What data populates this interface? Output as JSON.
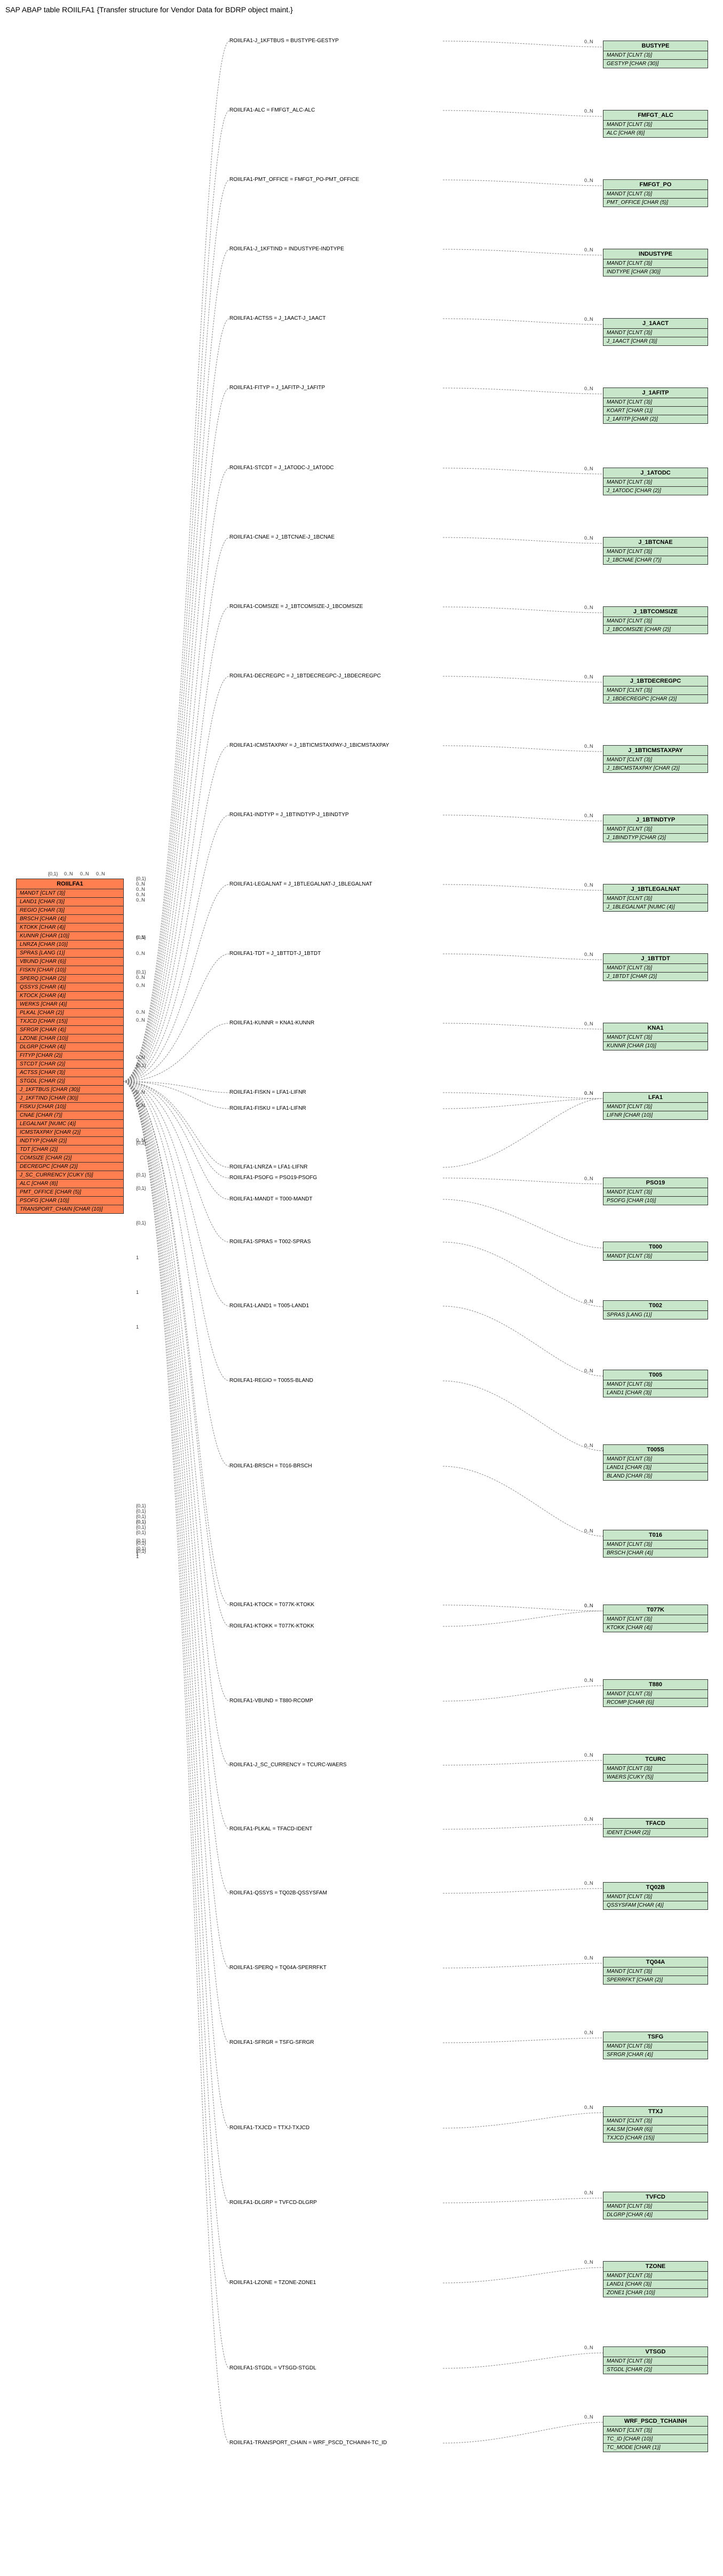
{
  "title": "SAP ABAP table ROIILFA1 {Transfer structure for Vendor Data for BDRP object maint.}",
  "main_entity": {
    "name": "ROIILFA1",
    "fields": [
      "MANDT [CLNT (3)]",
      "LAND1 [CHAR (3)]",
      "REGIO [CHAR (3)]",
      "BRSCH [CHAR (4)]",
      "KTOKK [CHAR (4)]",
      "KUNNR [CHAR (10)]",
      "LNRZA [CHAR (10)]",
      "SPRAS [LANG (1)]",
      "VBUND [CHAR (6)]",
      "FISKN [CHAR (10)]",
      "SPERQ [CHAR (2)]",
      "QSSYS [CHAR (4)]",
      "KTOCK [CHAR (4)]",
      "WERKS [CHAR (4)]",
      "PLKAL [CHAR (2)]",
      "TXJCD [CHAR (15)]",
      "SFRGR [CHAR (4)]",
      "LZONE [CHAR (10)]",
      "DLGRP [CHAR (4)]",
      "FITYP [CHAR (2)]",
      "STCDT [CHAR (2)]",
      "ACTSS [CHAR (3)]",
      "STGDL [CHAR (2)]",
      "J_1KFTBUS [CHAR (30)]",
      "J_1KFTIND [CHAR (30)]",
      "FISKU [CHAR (10)]",
      "CNAE [CHAR (7)]",
      "LEGALNAT [NUMC (4)]",
      "ICMSTAXPAY [CHAR (2)]",
      "INDTYP [CHAR (2)]",
      "TDT [CHAR (2)]",
      "COMSIZE [CHAR (2)]",
      "DECREGPC [CHAR (2)]",
      "J_SC_CURRENCY [CUKY (5)]",
      "ALC [CHAR (8)]",
      "PMT_OFFICE [CHAR (5)]",
      "PSOFG [CHAR (10)]",
      "TRANSPORT_CHAIN [CHAR (10)]"
    ]
  },
  "src_cards": [
    "{0,1}",
    "0..N",
    "0..N",
    "0..N",
    "0..N",
    "0..N",
    "0..N",
    "0..N",
    "0..N",
    "0..N",
    "0..N",
    "0..N",
    "0..N",
    "0..N",
    "0..N",
    "{0,1}",
    "{0,1}",
    "{0,1}",
    "{0,1}",
    "1",
    "1",
    "1",
    "{0,1}",
    "{0,1}",
    "{0,1}",
    "{0,1}",
    "{0,1}",
    "{0,1}",
    "{0,1}",
    "{0,1}",
    "{0,1}",
    "{0,1}",
    "{0,1}",
    "{0,1}",
    "{0,1}",
    "{0,1}",
    "1",
    "1"
  ],
  "src_card_left": [
    "{0,1}",
    "0..N",
    "0..N",
    "0..N"
  ],
  "edges": [
    {
      "label": "ROIILFA1-J_1KFTBUS = BUSTYPE-GESTYP",
      "card": "0..N"
    },
    {
      "label": "ROIILFA1-ALC = FMFGT_ALC-ALC",
      "card": "0..N"
    },
    {
      "label": "ROIILFA1-PMT_OFFICE = FMFGT_PO-PMT_OFFICE",
      "card": "0..N"
    },
    {
      "label": "ROIILFA1-J_1KFTIND = INDUSTYPE-INDTYPE",
      "card": "0..N"
    },
    {
      "label": "ROIILFA1-ACTSS = J_1AACT-J_1AACT",
      "card": "0..N"
    },
    {
      "label": "ROIILFA1-FITYP = J_1AFITP-J_1AFITP",
      "card": "0..N"
    },
    {
      "label": "ROIILFA1-STCDT = J_1ATODC-J_1ATODC",
      "card": "0..N"
    },
    {
      "label": "ROIILFA1-CNAE = J_1BTCNAE-J_1BCNAE",
      "card": "0..N"
    },
    {
      "label": "ROIILFA1-COMSIZE = J_1BTCOMSIZE-J_1BCOMSIZE",
      "card": "0..N"
    },
    {
      "label": "ROIILFA1-DECREGPC = J_1BTDECREGPC-J_1BDECREGPC",
      "card": "0..N"
    },
    {
      "label": "ROIILFA1-ICMSTAXPAY = J_1BTICMSTAXPAY-J_1BICMSTAXPAY",
      "card": "0..N"
    },
    {
      "label": "ROIILFA1-INDTYP = J_1BTINDTYP-J_1BINDTYP",
      "card": "0..N"
    },
    {
      "label": "ROIILFA1-LEGALNAT = J_1BTLEGALNAT-J_1BLEGALNAT",
      "card": "0..N"
    },
    {
      "label": "ROIILFA1-TDT = J_1BTTDT-J_1BTDT",
      "card": "0..N"
    },
    {
      "label": "ROIILFA1-KUNNR = KNA1-KUNNR",
      "card": "0..N"
    },
    {
      "label": "ROIILFA1-FISKN = LFA1-LIFNR",
      "card": "0..N"
    },
    {
      "label": "ROIILFA1-FISKU = LFA1-LIFNR",
      "card": "0..N"
    },
    {
      "label": "ROIILFA1-LNRZA = LFA1-LIFNR",
      "card": ""
    },
    {
      "label": "ROIILFA1-PSOFG = PSO19-PSOFG",
      "card": "0..N"
    },
    {
      "label": "ROIILFA1-MANDT = T000-MANDT",
      "card": ""
    },
    {
      "label": "ROIILFA1-SPRAS = T002-SPRAS",
      "card": "0..N"
    },
    {
      "label": "ROIILFA1-LAND1 = T005-LAND1",
      "card": "0..N"
    },
    {
      "label": "ROIILFA1-REGIO = T005S-BLAND",
      "card": "0..N"
    },
    {
      "label": "ROIILFA1-BRSCH = T016-BRSCH",
      "card": "0..N"
    },
    {
      "label": "ROIILFA1-KTOCK = T077K-KTOKK",
      "card": "0..N"
    },
    {
      "label": "ROIILFA1-KTOKK = T077K-KTOKK",
      "card": "0..N"
    },
    {
      "label": "ROIILFA1-VBUND = T880-RCOMP",
      "card": "0..N"
    },
    {
      "label": "ROIILFA1-J_SC_CURRENCY = TCURC-WAERS",
      "card": "0..N"
    },
    {
      "label": "ROIILFA1-PLKAL = TFACD-IDENT",
      "card": "0..N"
    },
    {
      "label": "ROIILFA1-QSSYS = TQ02B-QSSYSFAM",
      "card": "0..N"
    },
    {
      "label": "ROIILFA1-SPERQ = TQ04A-SPERRFKT",
      "card": "0..N"
    },
    {
      "label": "ROIILFA1-SFRGR = TSFG-SFRGR",
      "card": "0..N"
    },
    {
      "label": "ROIILFA1-TXJCD = TTXJ-TXJCD",
      "card": "0..N"
    },
    {
      "label": "ROIILFA1-DLGRP = TVFCD-DLGRP",
      "card": "0..N"
    },
    {
      "label": "ROIILFA1-LZONE = TZONE-ZONE1",
      "card": "0..N"
    },
    {
      "label": "ROIILFA1-STGDL = VTSGD-STGDL",
      "card": "0..N"
    },
    {
      "label": "ROIILFA1-TRANSPORT_CHAIN = WRF_PSCD_TCHAINH-TC_ID",
      "card": "0..N"
    }
  ],
  "targets": [
    {
      "name": "BUSTYPE",
      "fields": [
        "MANDT [CLNT (3)]",
        "GESTYP [CHAR (30)]"
      ]
    },
    {
      "name": "FMFGT_ALC",
      "fields": [
        "MANDT [CLNT (3)]",
        "ALC [CHAR (8)]"
      ]
    },
    {
      "name": "FMFGT_PO",
      "fields": [
        "MANDT [CLNT (3)]",
        "PMT_OFFICE [CHAR (5)]"
      ]
    },
    {
      "name": "INDUSTYPE",
      "fields": [
        "MANDT [CLNT (3)]",
        "INDTYPE [CHAR (30)]"
      ]
    },
    {
      "name": "J_1AACT",
      "fields": [
        "MANDT [CLNT (3)]",
        "J_1AACT [CHAR (3)]"
      ]
    },
    {
      "name": "J_1AFITP",
      "fields": [
        "MANDT [CLNT (3)]",
        "KOART [CHAR (1)]",
        "J_1AFITP [CHAR (2)]"
      ]
    },
    {
      "name": "J_1ATODC",
      "fields": [
        "MANDT [CLNT (3)]",
        "J_1ATODC [CHAR (2)]"
      ]
    },
    {
      "name": "J_1BTCNAE",
      "fields": [
        "MANDT [CLNT (3)]",
        "J_1BCNAE [CHAR (7)]"
      ]
    },
    {
      "name": "J_1BTCOMSIZE",
      "fields": [
        "MANDT [CLNT (3)]",
        "J_1BCOMSIZE [CHAR (2)]"
      ]
    },
    {
      "name": "J_1BTDECREGPC",
      "fields": [
        "MANDT [CLNT (3)]",
        "J_1BDECREGPC [CHAR (2)]"
      ]
    },
    {
      "name": "J_1BTICMSTAXPAY",
      "fields": [
        "MANDT [CLNT (3)]",
        "J_1BICMSTAXPAY [CHAR (2)]"
      ]
    },
    {
      "name": "J_1BTINDTYP",
      "fields": [
        "MANDT [CLNT (3)]",
        "J_1BINDTYP [CHAR (2)]"
      ]
    },
    {
      "name": "J_1BTLEGALNAT",
      "fields": [
        "MANDT [CLNT (3)]",
        "J_1BLEGALNAT [NUMC (4)]"
      ]
    },
    {
      "name": "J_1BTTDT",
      "fields": [
        "MANDT [CLNT (3)]",
        "J_1BTDT [CHAR (2)]"
      ]
    },
    {
      "name": "KNA1",
      "fields": [
        "MANDT [CLNT (3)]",
        "KUNNR [CHAR (10)]"
      ]
    },
    {
      "name": "LFA1",
      "fields": [
        "MANDT [CLNT (3)]",
        "LIFNR [CHAR (10)]"
      ]
    },
    {
      "name": "PSO19",
      "fields": [
        "MANDT [CLNT (3)]",
        "PSOFG [CHAR (10)]"
      ]
    },
    {
      "name": "T000",
      "fields": [
        "MANDT [CLNT (3)]"
      ]
    },
    {
      "name": "T002",
      "fields": [
        "SPRAS [LANG (1)]"
      ]
    },
    {
      "name": "T005",
      "fields": [
        "MANDT [CLNT (3)]",
        "LAND1 [CHAR (3)]"
      ]
    },
    {
      "name": "T005S",
      "fields": [
        "MANDT [CLNT (3)]",
        "LAND1 [CHAR (3)]",
        "BLAND [CHAR (3)]"
      ]
    },
    {
      "name": "T016",
      "fields": [
        "MANDT [CLNT (3)]",
        "BRSCH [CHAR (4)]"
      ]
    },
    {
      "name": "T077K",
      "fields": [
        "MANDT [CLNT (3)]",
        "KTOKK [CHAR (4)]"
      ]
    },
    {
      "name": "T880",
      "fields": [
        "MANDT [CLNT (3)]",
        "RCOMP [CHAR (6)]"
      ]
    },
    {
      "name": "TCURC",
      "fields": [
        "MANDT [CLNT (3)]",
        "WAERS [CUKY (5)]"
      ]
    },
    {
      "name": "TFACD",
      "fields": [
        "IDENT [CHAR (2)]"
      ]
    },
    {
      "name": "TQ02B",
      "fields": [
        "MANDT [CLNT (3)]",
        "QSSYSFAM [CHAR (4)]"
      ]
    },
    {
      "name": "TQ04A",
      "fields": [
        "MANDT [CLNT (3)]",
        "SPERRFKT [CHAR (2)]"
      ]
    },
    {
      "name": "TSFG",
      "fields": [
        "MANDT [CLNT (3)]",
        "SFRGR [CHAR (4)]"
      ]
    },
    {
      "name": "TTXJ",
      "fields": [
        "MANDT [CLNT (3)]",
        "KALSM [CHAR (6)]",
        "TXJCD [CHAR (15)]"
      ]
    },
    {
      "name": "TVFCD",
      "fields": [
        "MANDT [CLNT (3)]",
        "DLGRP [CHAR (4)]"
      ]
    },
    {
      "name": "TZONE",
      "fields": [
        "MANDT [CLNT (3)]",
        "LAND1 [CHAR (3)]",
        "ZONE1 [CHAR (10)]"
      ]
    },
    {
      "name": "VTSGD",
      "fields": [
        "MANDT [CLNT (3)]",
        "STGDL [CHAR (2)]"
      ]
    },
    {
      "name": "WRF_PSCD_TCHAINH",
      "fields": [
        "MANDT [CLNT (3)]",
        "TC_ID [CHAR (10)]",
        "TC_MODE [CHAR (1)]"
      ]
    }
  ],
  "target_y": [
    40,
    170,
    300,
    430,
    560,
    690,
    840,
    970,
    1100,
    1230,
    1360,
    1490,
    1620,
    1750,
    1880,
    2010,
    2170,
    2290,
    2400,
    2530,
    2670,
    2830,
    2970,
    3110,
    3250,
    3370,
    3490,
    3630,
    3770,
    3910,
    4070,
    4200,
    4360,
    4490,
    4630
  ],
  "edge_y": [
    35,
    165,
    295,
    425,
    555,
    685,
    835,
    965,
    1095,
    1225,
    1355,
    1485,
    1615,
    1745,
    1875,
    2005,
    2035,
    2145,
    2165,
    2205,
    2285,
    2405,
    2545,
    2705,
    2965,
    3005,
    3145,
    3265,
    3385,
    3505,
    3645,
    3785,
    3945,
    4085,
    4235,
    4395,
    4535
  ],
  "src_card_y": [
    1605,
    1615,
    1625,
    1635,
    1645,
    1715,
    1745,
    1790,
    1805,
    1855,
    1870,
    1940,
    2005,
    2030,
    2095,
    2100,
    2160,
    2185,
    2250,
    2315,
    2380,
    2445,
    1955,
    1780,
    2780,
    2790,
    2800,
    2810,
    2820,
    2830,
    1715,
    2810,
    2845,
    2850,
    2860,
    2865,
    2870,
    2875
  ]
}
